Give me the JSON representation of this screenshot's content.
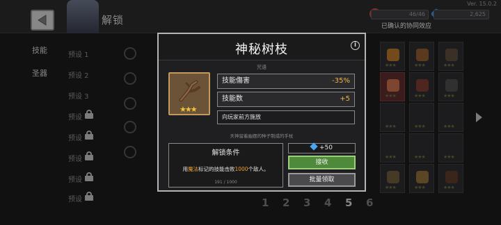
{
  "header": {
    "title": "解锁",
    "version": "Ver. 15.0.2",
    "stat_1": "46/46",
    "stat_2": "2,625",
    "coop_label": "已确认的协同效应"
  },
  "sidebar": {
    "tabs": [
      "技能",
      "圣器"
    ],
    "presets": [
      "预设 1",
      "预设 2",
      "预设 3",
      "预设",
      "预设",
      "预设",
      "预设",
      "预设"
    ]
  },
  "pager": [
    "1",
    "2",
    "3",
    "4",
    "5",
    "6"
  ],
  "modal": {
    "title": "神秘树枝",
    "subtitle": "咒语",
    "stats": [
      {
        "label": "技能傷害",
        "value": "-35%"
      },
      {
        "label": "技能数",
        "value": "+5"
      }
    ],
    "description": "向玩家前方施放",
    "flavor": "天神留着幽摆的种子制成的手杖",
    "unlock": {
      "title": "解锁条件",
      "desc_prefix": "用",
      "desc_highlight_1": "魔法",
      "desc_middle": "标记的技能击败",
      "desc_highlight_2": "1000",
      "desc_suffix": "个敌人。",
      "progress": "191 / 1000"
    },
    "reward": "+50",
    "claim_label": "接收",
    "bulk_label": "批量领取",
    "info_label": "i",
    "rarity_stars": "★★★"
  },
  "colors": {
    "accent_gold": "#f0b846",
    "claim_green": "#4e8a3a",
    "item_frame": "#c49a5c"
  },
  "icons": [
    "back-arrow-icon",
    "info-icon",
    "gem-icon",
    "lock-icon",
    "branch-item-icon"
  ]
}
